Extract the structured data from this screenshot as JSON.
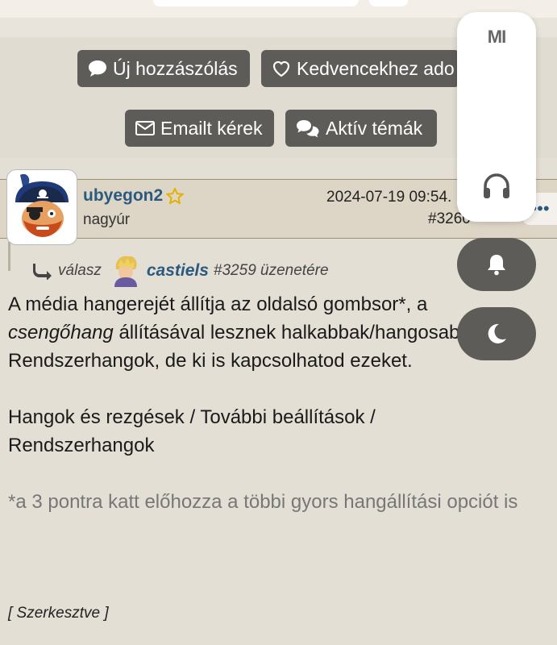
{
  "actions": {
    "new_post": "Új hozzászólás",
    "favorite": "Kedvencekhez ado",
    "email": "Emailt kérek",
    "active": "Aktív témák"
  },
  "post": {
    "username": "ubyegon2",
    "rank": "nagyúr",
    "date": "2024-07-19 09:54.",
    "number": "#3260",
    "more": "•••",
    "reply_prefix": "válasz",
    "reply_user": "castiels",
    "reply_suffix": "#3259 üzenetére",
    "body_1_a": "A média hangerejét állítja az oldalsó gombsor*, a",
    "body_1_italic": "csengőhang",
    "body_1_b": " állításával lesznek halkabbak/hangosabbak a Rendszerhangok, de ki is kapcsolhatod ezeket.",
    "body_2": "Hangok és rezgések / További beállítások / Rendszerhangok",
    "body_3": "*a 3 pontra katt előhozza a többi gyors hangállítási opciót is",
    "edited": "[ Szerkesztve ]"
  },
  "volume_panel": {
    "brand": "MI",
    "icons": [
      "headphones-icon",
      "bell-icon",
      "moon-icon"
    ]
  }
}
